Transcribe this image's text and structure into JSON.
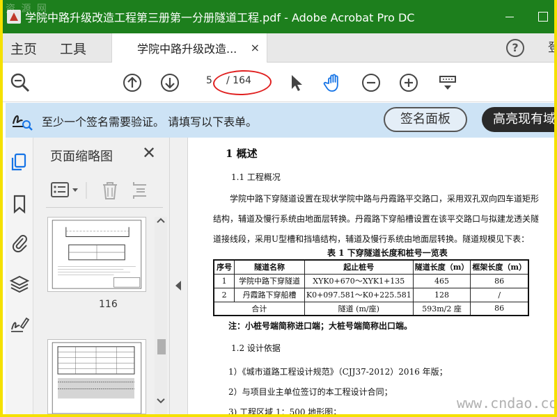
{
  "window": {
    "title": "学院中路升级改造工程第三册第一分册隧道工程.pdf - Adobe Acrobat Pro DC",
    "watermark_top": "资 源 网",
    "watermark_bottom": "www.cndao.com"
  },
  "tabs": {
    "home": "主页",
    "tools": "工具",
    "document_tab": "学院中路升级改造...",
    "close_glyph": "×",
    "help": "?",
    "login": "登"
  },
  "toolbar": {
    "current_page": "5",
    "total_pages": "/ 164"
  },
  "signature_bar": {
    "message": "至少一个签名需要验证。 请填写以下表单。",
    "sign_panel_button": "签名面板",
    "highlight_button": "高亮现有域"
  },
  "thumbnails": {
    "title": "页面缩略图",
    "close_glyph": "✕",
    "page_label": "116"
  },
  "document": {
    "heading1": "1 概述",
    "heading1_1": "1.1 工程概况",
    "paragraph": "学院中路下穿隧道设置在现状学院中路与丹霞路平交路口，采用双孔双向四车道矩形结构，辅道及慢行系统由地面层转换。丹霞路下穿船槽设置在该平交路口与拟建龙透关隧道接线段，采用U型槽和挡墙结构，辅道及慢行系统由地面层转换。隧道规模见下表：",
    "table_caption": "表 1    下穿隧道长度和桩号一览表",
    "table": {
      "headers": [
        "序号",
        "隧道名称",
        "起止桩号",
        "隧道长度（m）",
        "框架长度（m）"
      ],
      "rows": [
        [
          "1",
          "学院中路下穿隧道",
          "XYK0+670～XYK1+135",
          "465",
          "86"
        ],
        [
          "2",
          "丹霞路下穿船槽",
          "K0+097.581～K0+225.581",
          "128",
          "/"
        ]
      ],
      "total": [
        "合计",
        "隧道 (m/座)",
        "593m/2 座",
        "86"
      ]
    },
    "note": "注：小桩号端简称进口端；大桩号端简称出口端。",
    "heading1_2": "1.2 设计依据",
    "refs": [
      "1）《城市道路工程设计规范》（CJJ37-2012）2016 年版；",
      "2）与项目业主单位签订的本工程设计合同；",
      "3) 工程区域 1：500 地形图；"
    ]
  },
  "colors": {
    "title_bar": "#1d7f1d",
    "frame_border": "#f5e100",
    "signature_bar": "#cde3f5",
    "annotation_ellipse": "#e02020",
    "hand_tool": "#1473e6"
  }
}
